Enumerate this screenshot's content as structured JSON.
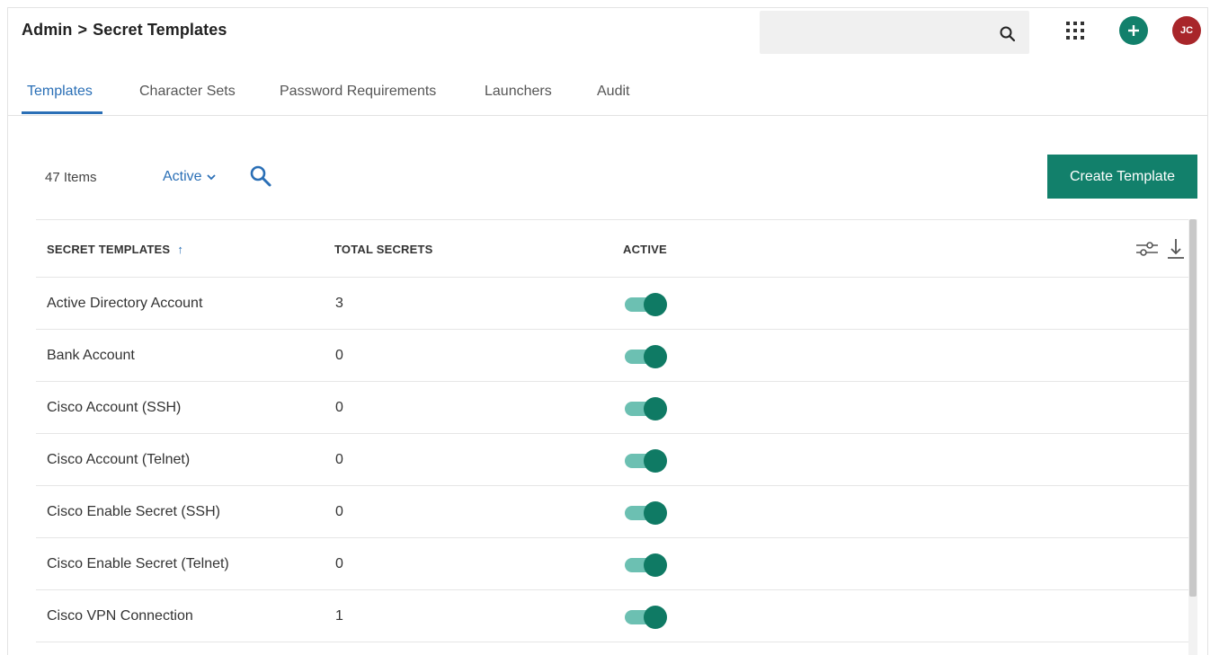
{
  "header": {
    "breadcrumb_root": "Admin",
    "breadcrumb_sep": ">",
    "breadcrumb_page": "Secret Templates",
    "search_placeholder": "",
    "avatar_initials": "JC",
    "search_icon": "search-icon",
    "apps_icon": "grid-apps-icon",
    "add_icon": "plus-icon"
  },
  "tabs": [
    {
      "label": "Templates",
      "active": true
    },
    {
      "label": "Character Sets",
      "active": false
    },
    {
      "label": "Password Requirements",
      "active": false
    },
    {
      "label": "Launchers",
      "active": false
    },
    {
      "label": "Audit",
      "active": false
    }
  ],
  "toolbar": {
    "item_count": "47 Items",
    "filter_value": "Active",
    "create_label": "Create Template"
  },
  "grid": {
    "columns": [
      "SECRET TEMPLATES",
      "TOTAL SECRETS",
      "ACTIVE"
    ],
    "sort_column": "SECRET TEMPLATES",
    "sort_direction": "ascending",
    "rows": [
      {
        "name": "Active Directory Account",
        "total": "3",
        "active": true
      },
      {
        "name": "Bank Account",
        "total": "0",
        "active": true
      },
      {
        "name": "Cisco Account (SSH)",
        "total": "0",
        "active": true
      },
      {
        "name": "Cisco Account (Telnet)",
        "total": "0",
        "active": true
      },
      {
        "name": "Cisco Enable Secret (SSH)",
        "total": "0",
        "active": true
      },
      {
        "name": "Cisco Enable Secret (Telnet)",
        "total": "0",
        "active": true
      },
      {
        "name": "Cisco VPN Connection",
        "total": "1",
        "active": true
      }
    ]
  },
  "colors": {
    "accent_blue": "#2a6fb6",
    "primary_green": "#12806b",
    "toggle_track": "#6cc0b2",
    "avatar_red": "#a8262a"
  }
}
